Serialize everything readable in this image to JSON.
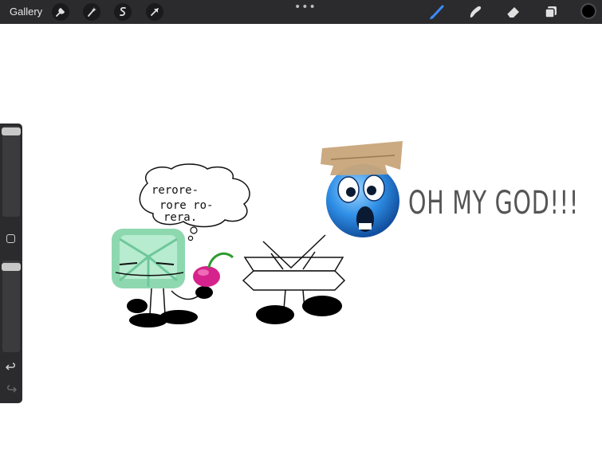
{
  "app": {
    "gallery_label": "Gallery",
    "more_menu": "•••",
    "current_color": "#000000",
    "accent_color": "#3d8bfd"
  },
  "toolbar_left_icons": [
    "wrench-icon",
    "magic-wand-icon",
    "selection-icon",
    "transform-arrow-icon"
  ],
  "toolbar_right_icons": [
    "brush-icon",
    "smudge-icon",
    "eraser-icon",
    "layers-icon"
  ],
  "sidebar": {
    "brush_size_level": 0.97,
    "opacity_level": 0.92,
    "modify_icon": "square-icon",
    "undo_icon": "undo-icon",
    "redo_icon": "redo-icon"
  },
  "canvas": {
    "thought_bubble_line1": "rerore-",
    "thought_bubble_line2": "rore ro-",
    "thought_bubble_line3": "rera.",
    "exclamation": "OH MY GOD!!!"
  }
}
